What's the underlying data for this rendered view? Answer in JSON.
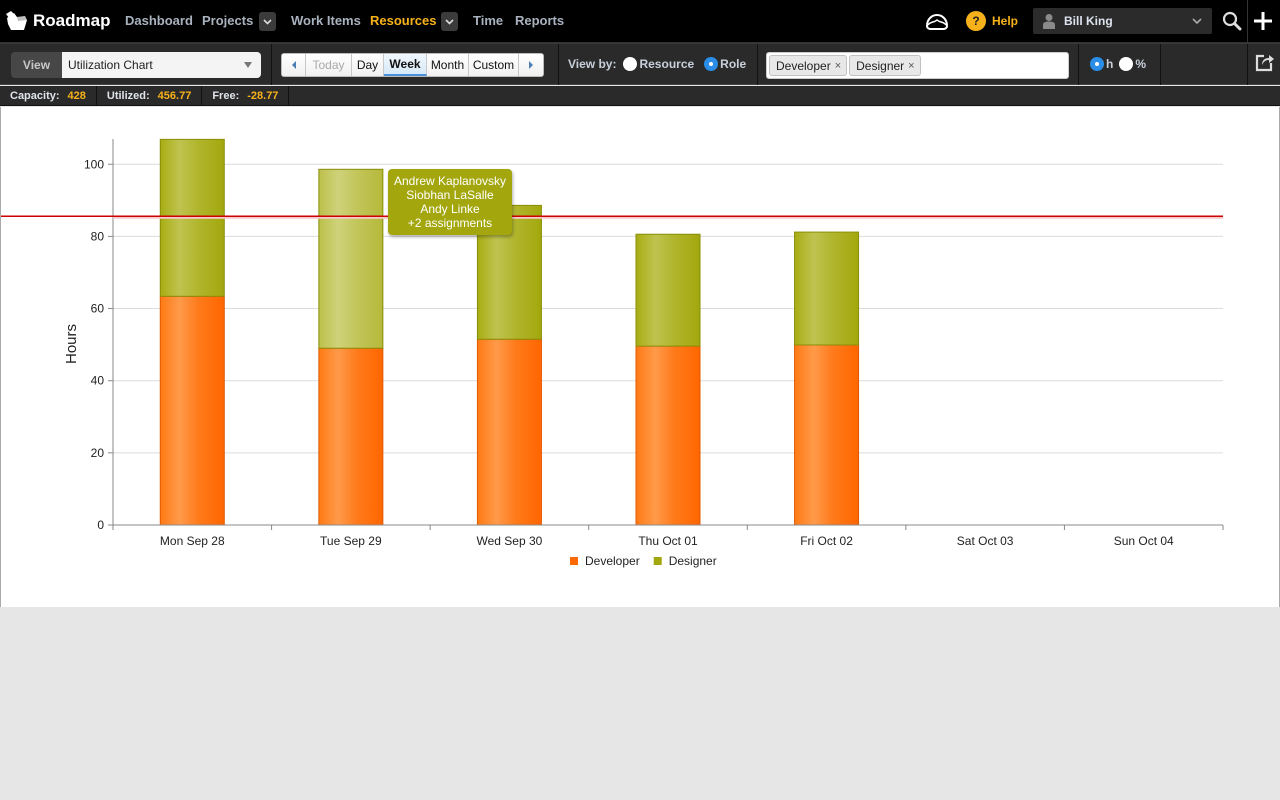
{
  "nav": {
    "brand": "Roadmap",
    "items": [
      {
        "label": "Dashboard",
        "active": false
      },
      {
        "label": "Projects",
        "active": false,
        "dropdown": true
      },
      {
        "label": "Work Items",
        "active": false
      },
      {
        "label": "Resources",
        "active": true,
        "dropdown": true
      },
      {
        "label": "Time",
        "active": false
      },
      {
        "label": "Reports",
        "active": false
      }
    ],
    "help_label": "Help",
    "help_glyph": "?",
    "user_name": "Bill King",
    "icons": [
      "logo-icon",
      "cloud-icon",
      "help-icon",
      "user-avatar-icon",
      "chevron-down-icon",
      "search-icon",
      "plus-icon"
    ],
    "accent_color": "#f7b21b"
  },
  "toolbar": {
    "view_label": "View",
    "view_value": "Utilization Chart",
    "date_buttons": [
      {
        "label": "Today",
        "state": "disabled"
      },
      {
        "label": "Day",
        "state": "normal"
      },
      {
        "label": "Week",
        "state": "active"
      },
      {
        "label": "Month",
        "state": "normal"
      },
      {
        "label": "Custom",
        "state": "normal"
      }
    ],
    "view_by_label": "View by:",
    "view_by_options": [
      {
        "label": "Resource",
        "selected": false
      },
      {
        "label": "Role",
        "selected": true
      }
    ],
    "role_tags": [
      "Developer",
      "Designer"
    ],
    "tag_remove_glyph": "×",
    "unit_options": [
      {
        "label": "h",
        "selected": true
      },
      {
        "label": "%",
        "selected": false
      }
    ]
  },
  "stats": {
    "capacity_label": "Capacity:",
    "capacity_value": "428",
    "utilized_label": "Utilized:",
    "utilized_value": "456.77",
    "free_label": "Free:",
    "free_value": "-28.77"
  },
  "tooltip": {
    "lines": [
      "Andrew Kaplanovsky",
      "Siobhan LaSalle",
      "Andy Linke",
      "+2 assignments"
    ]
  },
  "chart_data": {
    "type": "bar",
    "stacked": true,
    "title": "",
    "xlabel": "",
    "ylabel": "Hours",
    "ylim": [
      0,
      107
    ],
    "yticks": [
      0,
      20,
      40,
      60,
      80,
      100
    ],
    "grid": true,
    "categories": [
      "Mon Sep 28",
      "Tue Sep 29",
      "Wed Sep 30",
      "Thu Oct 01",
      "Fri Oct 02",
      "Sat Oct 03",
      "Sun Oct 04"
    ],
    "series": [
      {
        "name": "Developer",
        "color": "#ff6a00",
        "values": [
          63.4,
          49.0,
          51.5,
          49.6,
          49.9,
          0,
          0
        ]
      },
      {
        "name": "Designer",
        "color": "#a3a70d",
        "values": [
          43.5,
          49.6,
          37.1,
          31.0,
          31.3,
          0,
          0
        ]
      }
    ],
    "capacity_line": {
      "value": 85.6,
      "color": "#cc0000"
    },
    "legend": "bottom-center",
    "highlighted": {
      "category": "Tue Sep 29",
      "series": "Designer"
    }
  }
}
